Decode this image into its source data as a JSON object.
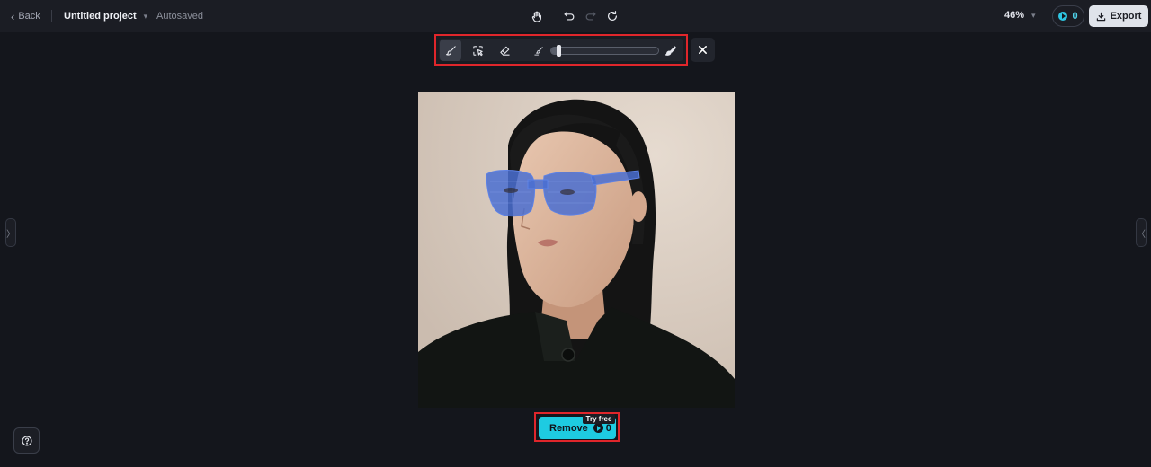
{
  "header": {
    "back_label": "Back",
    "project_name": "Untitled project",
    "save_status": "Autosaved",
    "zoom_level": "46%",
    "credits_count": "0",
    "export_label": "Export"
  },
  "icons": {
    "hand": "hand-icon",
    "undo": "undo-icon",
    "redo": "redo-icon",
    "refresh": "refresh-icon",
    "brush": "brush-icon",
    "select": "quick-select-icon",
    "eraser": "eraser-icon",
    "brush_small": "brush-size-small-icon",
    "brush_large": "brush-size-large-icon",
    "close": "close-icon",
    "help": "help-icon"
  },
  "brush_toolbar": {
    "active_tool": "brush",
    "brush_size_fraction": 0.05
  },
  "actions": {
    "remove_label": "Remove",
    "remove_cost": "0",
    "try_free_badge": "Try free"
  },
  "colors": {
    "accent": "#1ecbe1",
    "highlight_border": "#e0262b",
    "mask": "#4a6fd1"
  }
}
